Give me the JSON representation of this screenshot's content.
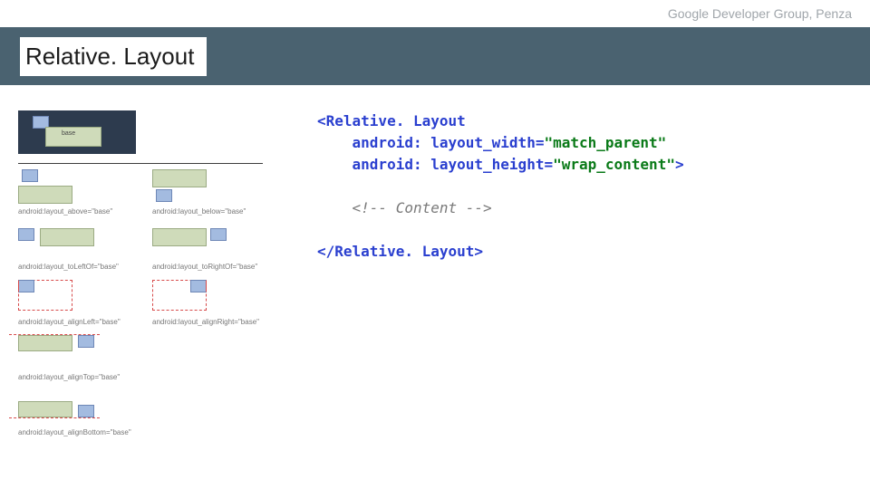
{
  "header_note": "Google Developer Group, Penza",
  "title": "Relative. Layout",
  "diagrams": {
    "base_label": "base",
    "captions": {
      "above": "android:layout_above=\"base\"",
      "below": "android:layout_below=\"base\"",
      "toLeftOf": "android:layout_toLeftOf=\"base\"",
      "toRightOf": "android:layout_toRightOf=\"base\"",
      "alignLeft": "android:layout_alignLeft=\"base\"",
      "alignRight": "android:layout_alignRight=\"base\"",
      "alignTop": "android:layout_alignTop=\"base\"",
      "alignBottom": "android:layout_alignBottom=\"base\""
    }
  },
  "code": {
    "open_tag": "<Relative. Layout",
    "attr1_name": "android: layout_width=",
    "attr1_val": "\"match_parent\"",
    "attr2_name": "android: layout_height=",
    "attr2_val": "\"wrap_content\"",
    "open_close": ">",
    "comment": "<!-- Content -->",
    "close_tag": "</Relative. Layout>"
  }
}
